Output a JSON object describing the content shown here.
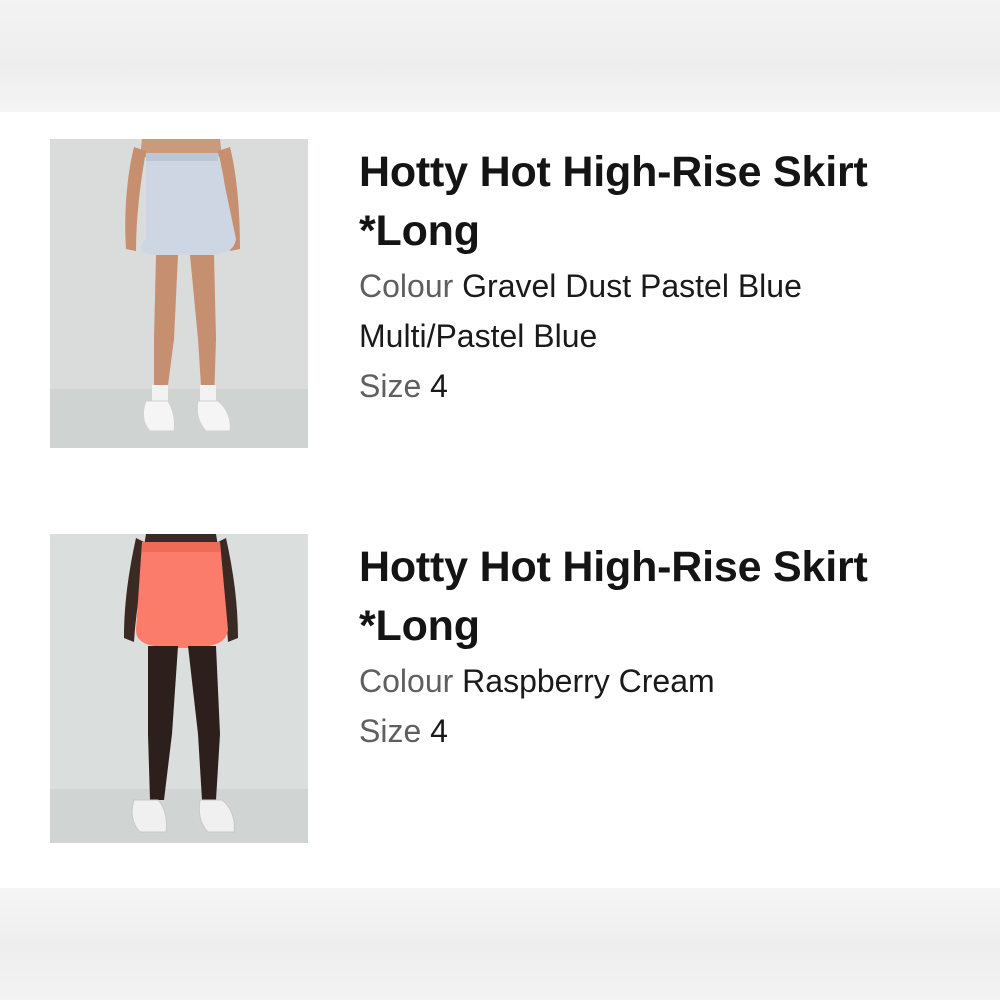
{
  "items": [
    {
      "title_line1": "Hotty Hot High-Rise Skirt",
      "title_line2": "*Long",
      "colour_label": "Colour",
      "colour_line1": "Gravel Dust Pastel Blue",
      "colour_line2": "Multi/Pastel Blue",
      "size_label": "Size",
      "size_value": "4",
      "skirt_color": "#cdd6e2"
    },
    {
      "title_line1": "Hotty Hot High-Rise Skirt",
      "title_line2": "*Long",
      "colour_label": "Colour",
      "colour_line1": "Raspberry Cream",
      "size_label": "Size",
      "size_value": "4",
      "skirt_color": "#fb7c6a"
    }
  ],
  "colors": {
    "title_text": "#141414",
    "label_text": "#5f5f5f",
    "photo_background": "#dadedc"
  }
}
